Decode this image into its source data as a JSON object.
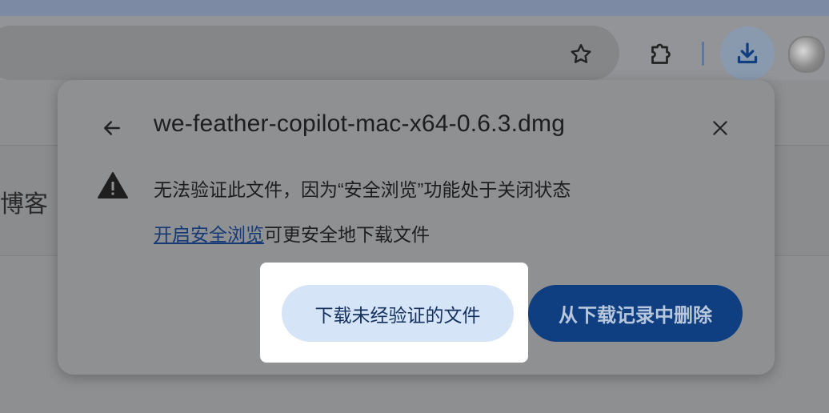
{
  "browser": {
    "toolbar": {
      "star_icon": "star-outline-icon",
      "extensions_icon": "puzzle-piece-icon",
      "download_icon": "download-icon",
      "avatar": "profile-avatar"
    }
  },
  "page": {
    "partial_text": "博客"
  },
  "download_popup": {
    "filename": "we-feather-copilot-mac-x64-0.6.3.dmg",
    "warning_text": "无法验证此文件，因为“安全浏览”功能处于关闭状态",
    "safe_browsing_link": "开启安全浏览",
    "safe_browsing_suffix": "可更安全地下载文件",
    "download_unverified_label": "下载未经验证的文件",
    "delete_label": "从下载记录中删除"
  },
  "colors": {
    "link": "#163a78",
    "primary_button": "#0f3f80",
    "secondary_button": "#d6e4f8",
    "spotlight": "#ffffff"
  }
}
